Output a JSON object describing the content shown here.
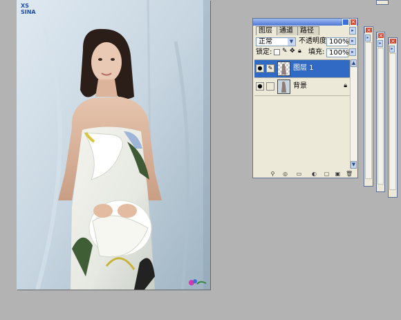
{
  "canvas": {
    "logo_top_left": "XS",
    "logo_top_left_sub": "SINA",
    "logo_bottom_right": "flower-logo"
  },
  "layers_palette": {
    "tabs": [
      "图层",
      "通道",
      "路径"
    ],
    "blend_mode": "正常",
    "opacity_label": "不透明度:",
    "opacity_value": "100%",
    "lock_label": "锁定:",
    "fill_label": "填充:",
    "fill_value": "100%",
    "layers": [
      {
        "name": "图层 1",
        "selected": true
      },
      {
        "name": "背景",
        "selected": false,
        "locked": true
      }
    ],
    "bottom_icons": [
      "link-icon",
      "layer-style-icon",
      "mask-icon",
      "new-set-icon",
      "adjustment-layer-icon",
      "new-layer-icon",
      "trash-icon"
    ]
  },
  "colors": {
    "workspace": "#b3b3b3",
    "palette_bg": "#ece9d8",
    "selection": "#316ac5",
    "titlebar": "#4f77d6"
  }
}
